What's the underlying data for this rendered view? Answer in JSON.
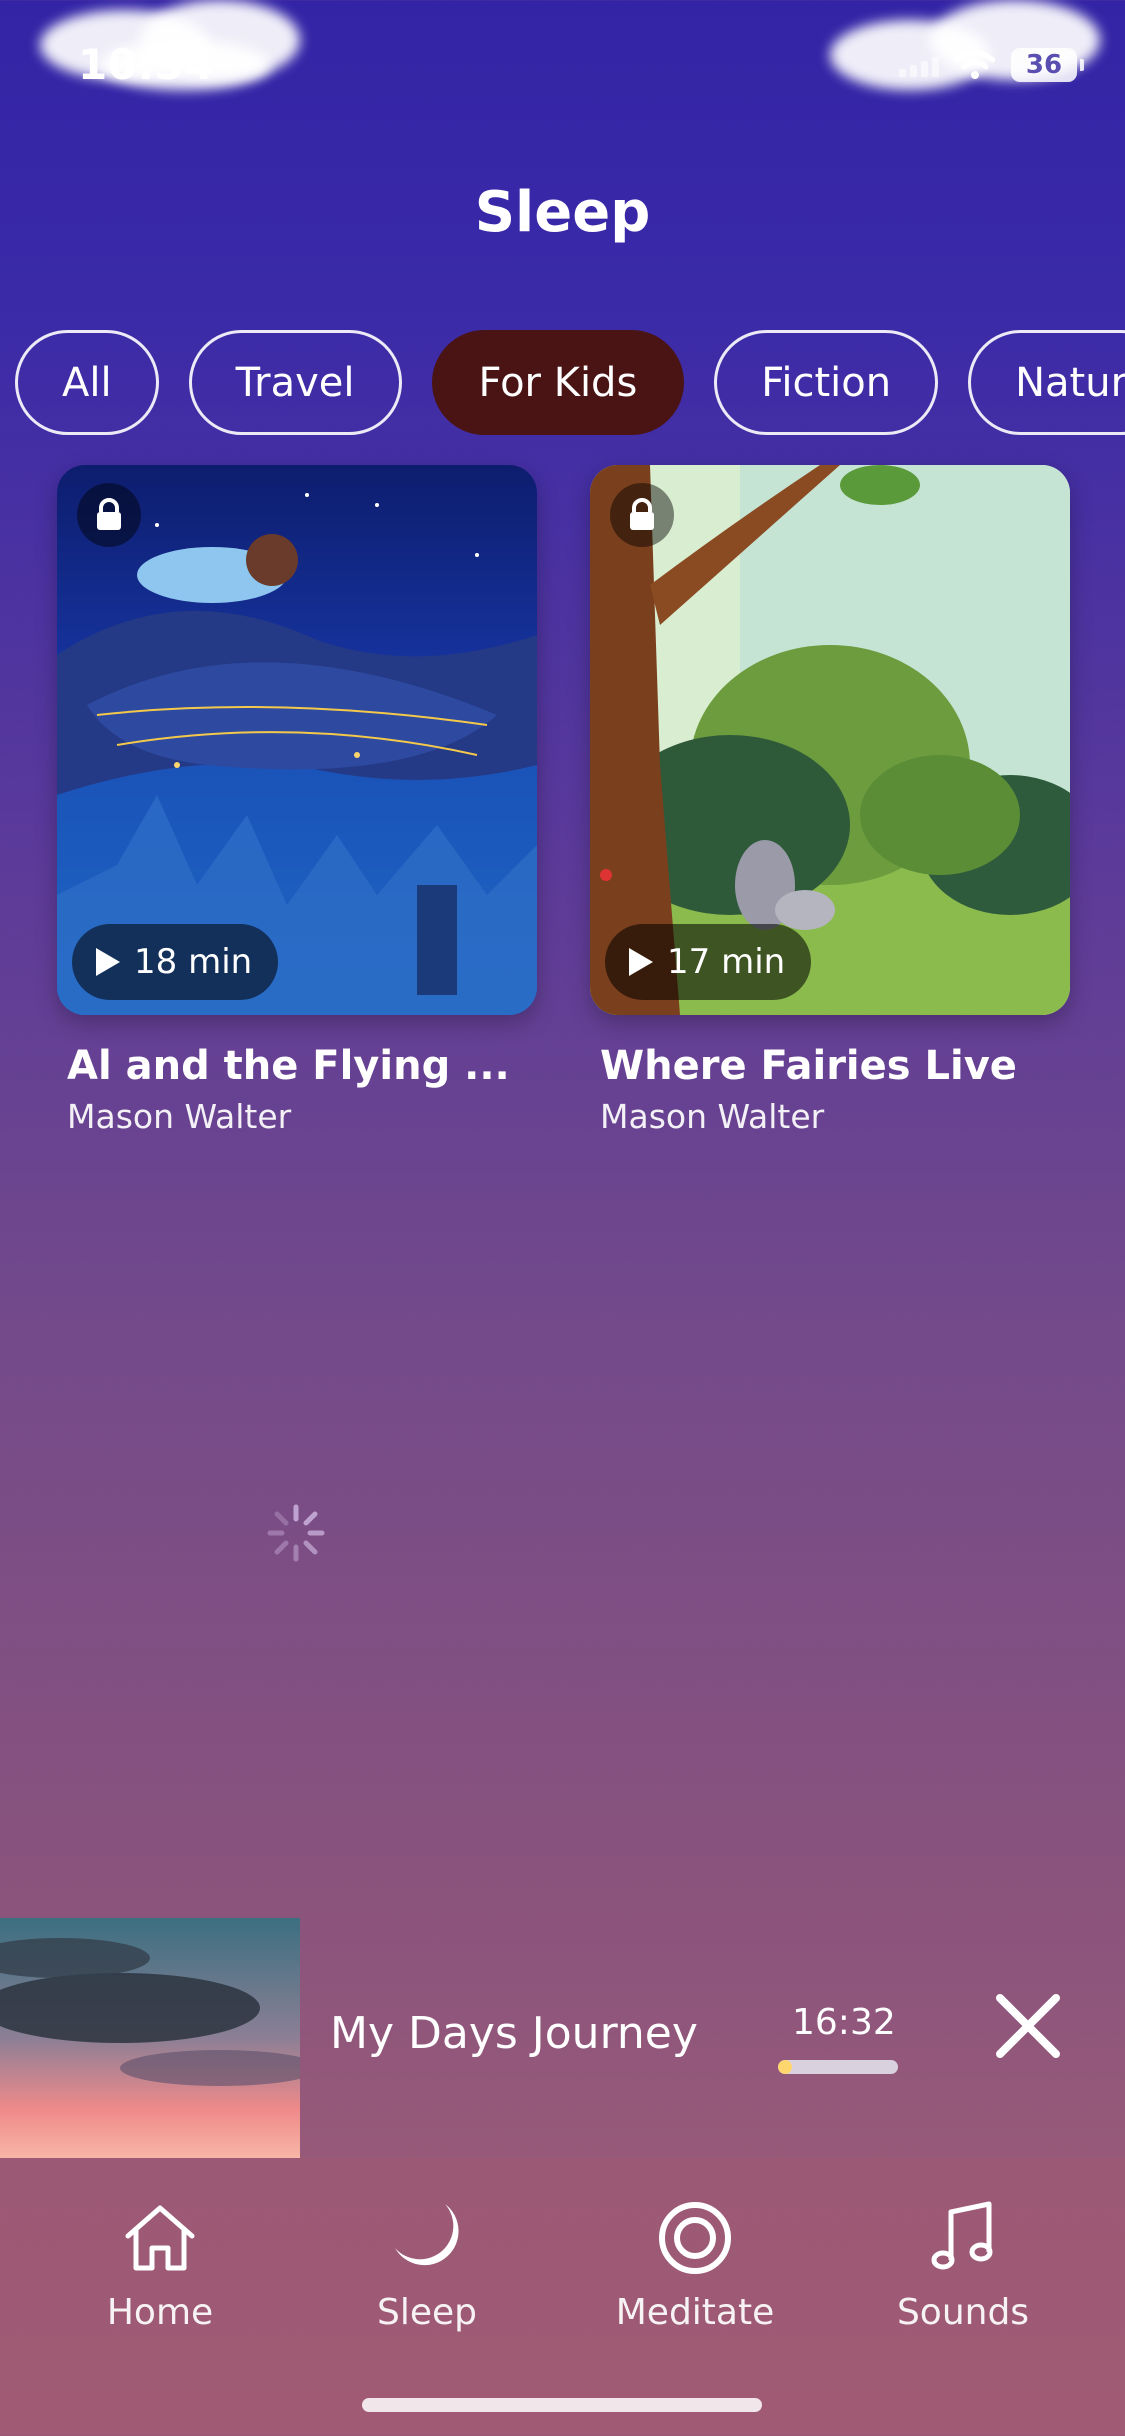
{
  "status_bar": {
    "time": "10:34",
    "battery": "36"
  },
  "header": {
    "title": "Sleep"
  },
  "categories": [
    {
      "label": "All",
      "active": false
    },
    {
      "label": "Travel",
      "active": false
    },
    {
      "label": "For Kids",
      "active": true
    },
    {
      "label": "Fiction",
      "active": false
    },
    {
      "label": "Natur",
      "active": false
    }
  ],
  "cards": [
    {
      "title": "Al and the Flying ...",
      "author": "Mason Walter",
      "duration": "18 min",
      "locked": true
    },
    {
      "title": "Where Fairies Live",
      "author": "Mason Walter",
      "duration": "17 min",
      "locked": true
    }
  ],
  "mini_player": {
    "title": "My Days Journey",
    "time": "16:32",
    "progress": 0.12
  },
  "tab_bar": {
    "items": [
      {
        "label": "Home",
        "icon": "home-icon"
      },
      {
        "label": "Sleep",
        "icon": "moon-icon",
        "active": true
      },
      {
        "label": "Meditate",
        "icon": "target-icon"
      },
      {
        "label": "Sounds",
        "icon": "music-note-icon"
      }
    ]
  },
  "colors": {
    "active_chip": "#4a1414",
    "progress_fill": "#ffd66e",
    "background_top": "#3324a6",
    "background_bottom": "#a05c75"
  }
}
